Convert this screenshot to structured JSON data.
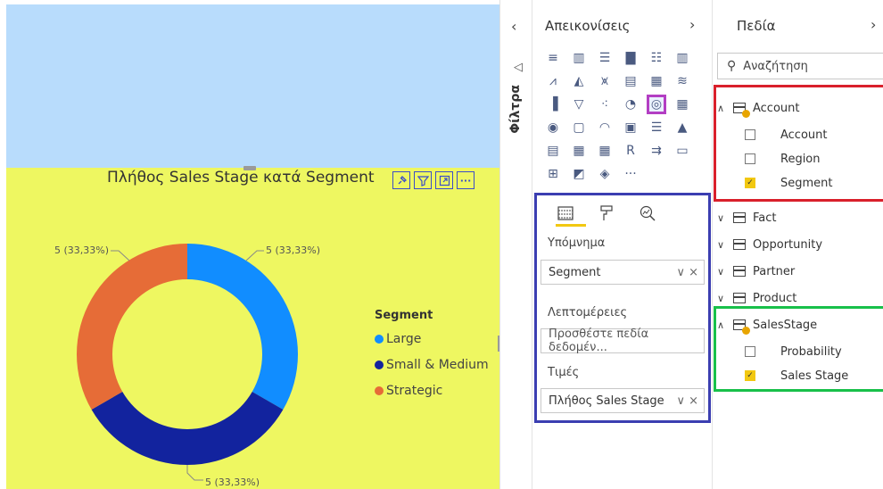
{
  "chart_data": {
    "type": "donut",
    "title": "Πλήθος Sales Stage κατά Segment",
    "legend_title": "Segment",
    "legend_position": "right",
    "categories": [
      "Large",
      "Small & Medium",
      "Strategic"
    ],
    "values": [
      5,
      5,
      5
    ],
    "data_labels": [
      "5 (33,33%)",
      "5 (33,33%)",
      "5 (33,33%)"
    ],
    "colors": [
      "#118DFF",
      "#12239E",
      "#E66C37"
    ]
  },
  "filters_pane": {
    "label": "Φίλτρα",
    "collapse_glyph": "‹",
    "icon_glyph": "◁"
  },
  "viz_pane": {
    "title": "Απεικονίσεις",
    "chevron": "›",
    "icons": [
      "stacked-bar",
      "stacked-column",
      "clustered-bar",
      "clustered-column",
      "100-bar",
      "100-column",
      "line",
      "area",
      "stacked-area",
      "line-column",
      "line-clustered",
      "ribbon",
      "waterfall",
      "funnel",
      "scatter",
      "pie",
      "donut",
      "treemap",
      "map",
      "filled-map",
      "gauge",
      "card",
      "multi-row-card",
      "kpi",
      "slicer",
      "table",
      "matrix",
      "r-visual",
      "decomposition",
      "qa",
      "key-influencers",
      "azure-map",
      "diamond",
      "more"
    ],
    "icon_glyphs": [
      "≡",
      "▥",
      "☰",
      "▇",
      "☷",
      "▥",
      "⩘",
      "◭",
      "⩙",
      "▤",
      "▦",
      "≋",
      "▐",
      "▽",
      "⁖",
      "◔",
      "◎",
      "▦",
      "◉",
      "▢",
      "◠",
      "▣",
      "☰",
      "▲",
      "▤",
      "▦",
      "▦",
      "R",
      "⇉",
      "▭",
      "⊞",
      "◩",
      "◈",
      "···"
    ],
    "selected_icon": "donut",
    "legend_label": "Υπόμνημα",
    "legend_field": "Segment",
    "details_label": "Λεπτομέρειες",
    "details_placeholder": "Προσθέστε πεδία δεδομέν...",
    "values_label": "Τιμές",
    "values_field": "Πλήθος Sales Stage",
    "well_controls": "∨ ×"
  },
  "fields_pane": {
    "title": "Πεδία",
    "chevron": "›",
    "search_placeholder": "Αναζήτηση",
    "tables": [
      {
        "name": "Account",
        "expanded": true,
        "active": true,
        "fields": [
          {
            "name": "Account",
            "checked": false
          },
          {
            "name": "Region",
            "checked": false
          },
          {
            "name": "Segment",
            "checked": true
          }
        ]
      },
      {
        "name": "Fact",
        "expanded": false,
        "active": false,
        "fields": []
      },
      {
        "name": "Opportunity",
        "expanded": false,
        "active": false,
        "fields": []
      },
      {
        "name": "Partner",
        "expanded": false,
        "active": false,
        "fields": []
      },
      {
        "name": "Product",
        "expanded": false,
        "active": false,
        "fields": []
      },
      {
        "name": "SalesStage",
        "expanded": true,
        "active": true,
        "fields": [
          {
            "name": "Probability",
            "checked": false
          },
          {
            "name": "Sales Stage",
            "checked": true
          }
        ]
      }
    ],
    "expand_glyph_open": "∧",
    "expand_glyph_closed": "∨"
  },
  "visual_header_icons": [
    "pin",
    "filter",
    "focus",
    "more"
  ],
  "visual_header_glyphs": [
    "⚲",
    "▽",
    "⤢",
    "···"
  ]
}
